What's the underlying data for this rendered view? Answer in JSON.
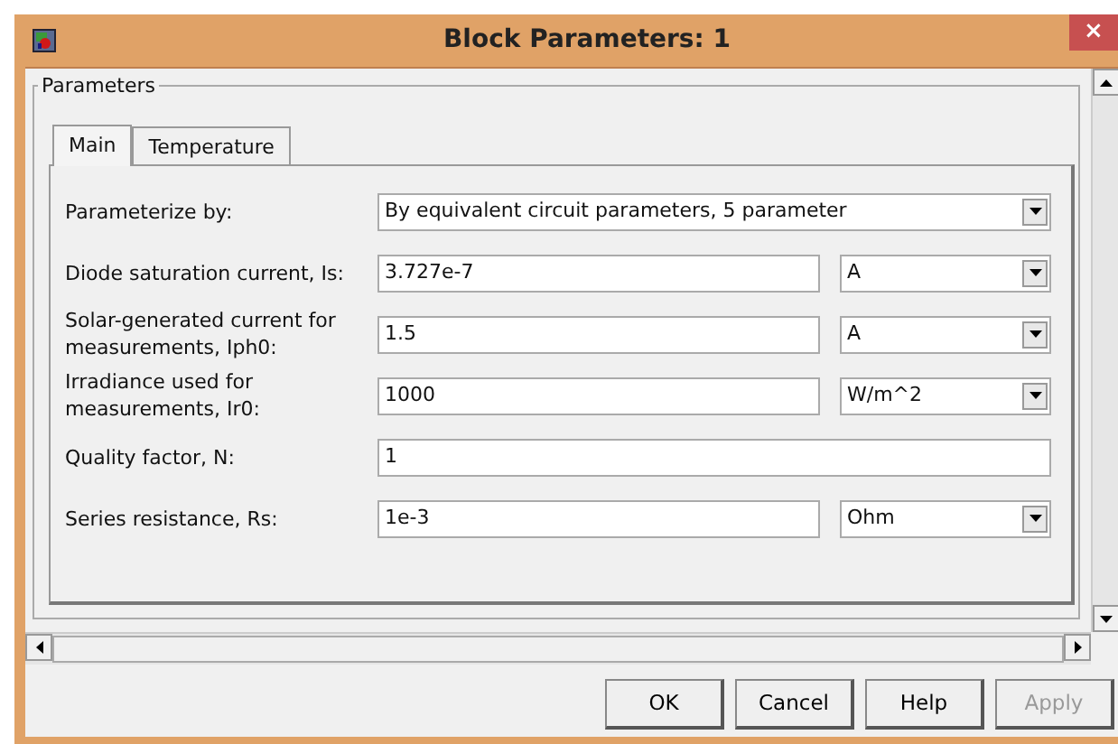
{
  "window": {
    "title": "Block Parameters: 1",
    "close": "×"
  },
  "group": {
    "title": "Parameters"
  },
  "tabs": [
    {
      "label": "Main",
      "selected": true
    },
    {
      "label": "Temperature",
      "selected": false
    }
  ],
  "rows": [
    {
      "kind": "select",
      "label": "Parameterize by:",
      "value": "By equivalent circuit parameters, 5 parameter"
    },
    {
      "kind": "value_unit",
      "label": "Diode saturation current, Is:",
      "value": "3.727e-7",
      "unit": "A"
    },
    {
      "kind": "value_unit",
      "label": "Solar-generated current for measurements, Iph0:",
      "value": "1.5",
      "unit": "A"
    },
    {
      "kind": "value_unit",
      "label": "Irradiance used for measurements, Ir0:",
      "value": "1000",
      "unit": "W/m^2"
    },
    {
      "kind": "value",
      "label": "Quality factor, N:",
      "value": "1"
    },
    {
      "kind": "value_unit",
      "label": "Series resistance, Rs:",
      "value": "1e-3",
      "unit": "Ohm"
    }
  ],
  "buttons": [
    {
      "label": "OK",
      "disabled": false
    },
    {
      "label": "Cancel",
      "disabled": false
    },
    {
      "label": "Help",
      "disabled": false
    },
    {
      "label": "Apply",
      "disabled": true
    }
  ]
}
